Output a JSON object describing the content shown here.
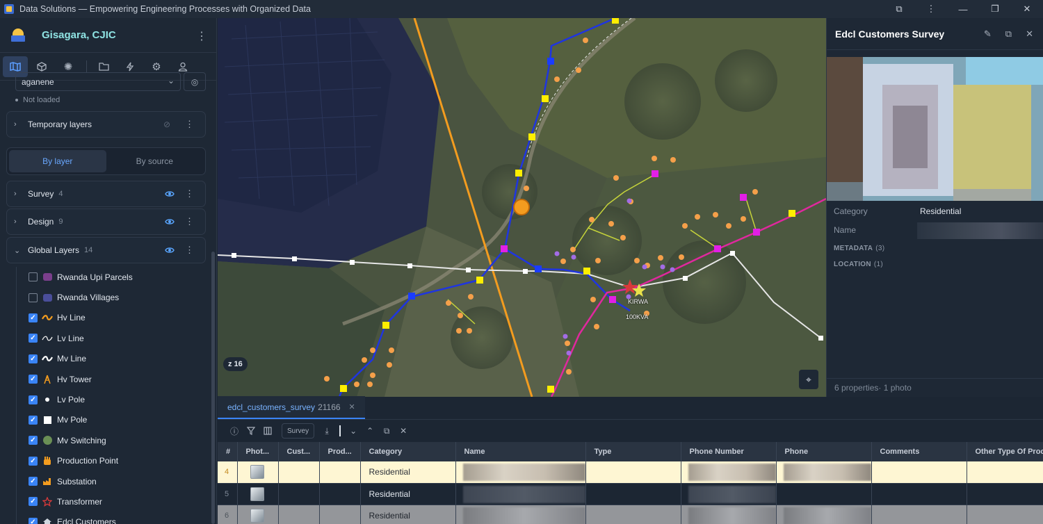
{
  "window": {
    "title": "Data Solutions — Empowering Engineering Processes with Organized Data",
    "controls": [
      "puzzle-icon",
      "more-icon",
      "minimize-icon",
      "restore-icon",
      "close-icon"
    ]
  },
  "project": {
    "name": "Gisagara, CJIC"
  },
  "sidebar_tabs": [
    "map-icon",
    "cube-icon",
    "sun-icon",
    "folder-icon",
    "bolt-icon",
    "gear-icon",
    "user-icon"
  ],
  "basemap": {
    "value": "aganene",
    "status": "Not loaded"
  },
  "temporary_layers": {
    "label": "Temporary layers"
  },
  "group_by": {
    "options": [
      "By layer",
      "By source"
    ],
    "selected": "By layer"
  },
  "groups": [
    {
      "label": "Survey",
      "count": "4",
      "visible": true,
      "expanded": false
    },
    {
      "label": "Design",
      "count": "9",
      "visible": true,
      "expanded": false
    },
    {
      "label": "Global Layers",
      "count": "14",
      "visible": true,
      "expanded": true
    }
  ],
  "layers": [
    {
      "name": "Rwanda Upi Parcels",
      "checked": false,
      "symbol": "purple-square",
      "color": "#7b3f8c"
    },
    {
      "name": "Rwanda Villages",
      "checked": false,
      "symbol": "indigo-square",
      "color": "#4a4e9a"
    },
    {
      "name": "Hv Line",
      "checked": true,
      "symbol": "orange-wave",
      "color": "#f39c1f"
    },
    {
      "name": "Lv Line",
      "checked": true,
      "symbol": "white-wave",
      "color": "#e8e8e8"
    },
    {
      "name": "Mv Line",
      "checked": true,
      "symbol": "white-wave",
      "color": "#ffffff"
    },
    {
      "name": "Hv Tower",
      "checked": true,
      "symbol": "tower-icon",
      "color": "#f39c1f"
    },
    {
      "name": "Lv Pole",
      "checked": true,
      "symbol": "white-dot",
      "color": "#ffffff"
    },
    {
      "name": "Mv Pole",
      "checked": true,
      "symbol": "white-square",
      "color": "#ffffff"
    },
    {
      "name": "Mv Switching",
      "checked": true,
      "symbol": "green-circle",
      "color": "#6a8f55"
    },
    {
      "name": "Production Point",
      "checked": true,
      "symbol": "hand-icon",
      "color": "#f39c1f"
    },
    {
      "name": "Substation",
      "checked": true,
      "symbol": "factory-icon",
      "color": "#f39c1f"
    },
    {
      "name": "Transformer",
      "checked": true,
      "symbol": "star-icon",
      "color": "#d83a3a"
    },
    {
      "name": "Edcl Customers",
      "checked": true,
      "symbol": "house-icon",
      "color": "#cfd6de"
    }
  ],
  "map": {
    "zoom_label": "z 16",
    "labels": [
      "KIRWA",
      "100KVA"
    ],
    "colors": {
      "hv": "#f39c1f",
      "mv_blue": "#1f35e0",
      "mv_magenta": "#e0289e",
      "lv": "#e6e6e6",
      "pole_yellow": "#ffee00",
      "pole_magenta": "#e21fe6",
      "pole_blue": "#1a3cff",
      "customer": "#f5a04a"
    }
  },
  "feature_panel": {
    "title": "Edcl Customers Survey",
    "actions": [
      "edit-icon",
      "open-external-icon",
      "close-icon"
    ],
    "properties": [
      {
        "key": "Category",
        "value": "Residential"
      },
      {
        "key": "Name",
        "value": ""
      }
    ],
    "sections": [
      {
        "label": "METADATA",
        "count": "(3)"
      },
      {
        "label": "LOCATION",
        "count": "(1)"
      }
    ],
    "footer": "6 properties· 1 photo"
  },
  "table": {
    "tab_name": "edcl_customers_survey",
    "tab_count": "21166",
    "filter_chip": "Survey",
    "columns": [
      "#",
      "Phot...",
      "Cust...",
      "Prod...",
      "Category",
      "Name",
      "Type",
      "Phone Number",
      "Phone",
      "Comments",
      "Other Type Of Proc"
    ],
    "rows": [
      {
        "num": "4",
        "category": "Residential",
        "style": "sel"
      },
      {
        "num": "5",
        "category": "Residential",
        "style": "norm"
      },
      {
        "num": "6",
        "category": "Residential",
        "style": "alt"
      }
    ]
  }
}
